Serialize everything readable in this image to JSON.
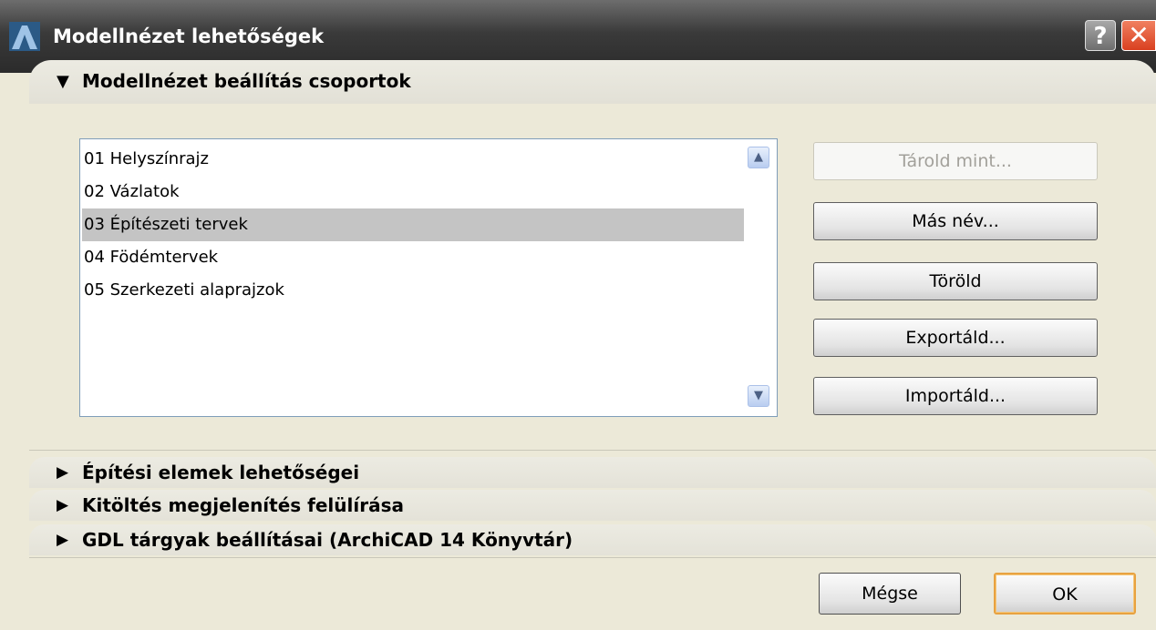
{
  "window": {
    "title": "Modellnézet lehetőségek",
    "help_glyph": "?",
    "close_glyph": "✕"
  },
  "sections": {
    "expanded": {
      "arrow": "▼",
      "label": "Modellnézet beállítás csoportok"
    },
    "collapsed": [
      {
        "arrow": "▶",
        "label": "Építési elemek lehetőségei"
      },
      {
        "arrow": "▶",
        "label": "Kitöltés megjelenítés felülírása"
      },
      {
        "arrow": "▶",
        "label": "GDL tárgyak beállításai (ArchiCAD 14 Könyvtár)"
      }
    ]
  },
  "list": {
    "items": [
      "01 Helyszínrajz",
      "02 Vázlatok",
      "03 Építészeti tervek",
      "04 Födémtervek",
      "05 Szerkezeti alaprajzok"
    ],
    "selected_index": 2,
    "scroll_up_glyph": "▲",
    "scroll_down_glyph": "▼"
  },
  "actions": {
    "store_as": "Tárold mint...",
    "rename": "Más név...",
    "delete": "Töröld",
    "export": "Exportáld...",
    "import": "Importáld..."
  },
  "footer": {
    "cancel": "Mégse",
    "ok": "OK"
  },
  "icons": {
    "app": "archicad-logo-icon",
    "help": "help-icon",
    "close": "close-icon"
  },
  "colors": {
    "titlebar": "#3a3a3a",
    "dialog_bg": "#ece9d8",
    "selection": "#c4c4c4",
    "close_red": "#d94020",
    "default_button_border": "#e8a240"
  }
}
